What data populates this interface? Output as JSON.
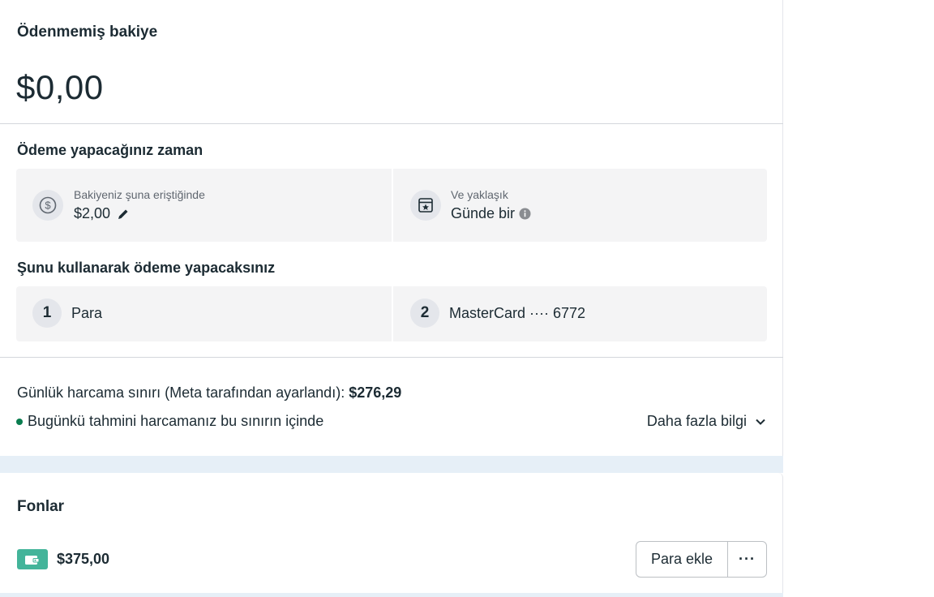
{
  "balance": {
    "title": "Ödenmemiş bakiye",
    "amount": "$0,00"
  },
  "billing": {
    "when_title": "Ödeme yapacağınız zaman",
    "threshold_label": "Bakiyeniz şuna eriştiğinde",
    "threshold_value": "$2,00",
    "threshold_icon": "dollar-circle-icon",
    "edit_icon": "pencil-icon",
    "schedule_label": "Ve yaklaşık",
    "schedule_value": "Günde bir",
    "schedule_icon": "calendar-star-icon",
    "info_icon": "info-icon"
  },
  "payment_methods": {
    "title": "Şunu kullanarak ödeme yapacaksınız",
    "items": [
      {
        "order": "1",
        "label": "Para"
      },
      {
        "order": "2",
        "label": "MasterCard ···· 6772"
      }
    ]
  },
  "spending": {
    "limit_prefix": "Günlük harcama sınırı (Meta tarafından ayarlandı): ",
    "limit_value": "$276,29",
    "status_text": "Bugünkü tahmini harcamanız bu sınırın içinde",
    "status_color": "#0a7d4f",
    "more_label": "Daha fazla bilgi"
  },
  "funds": {
    "title": "Fonlar",
    "amount": "$375,00",
    "wallet_color": "#43b49a",
    "add_button": "Para ekle",
    "more_button": "···"
  }
}
